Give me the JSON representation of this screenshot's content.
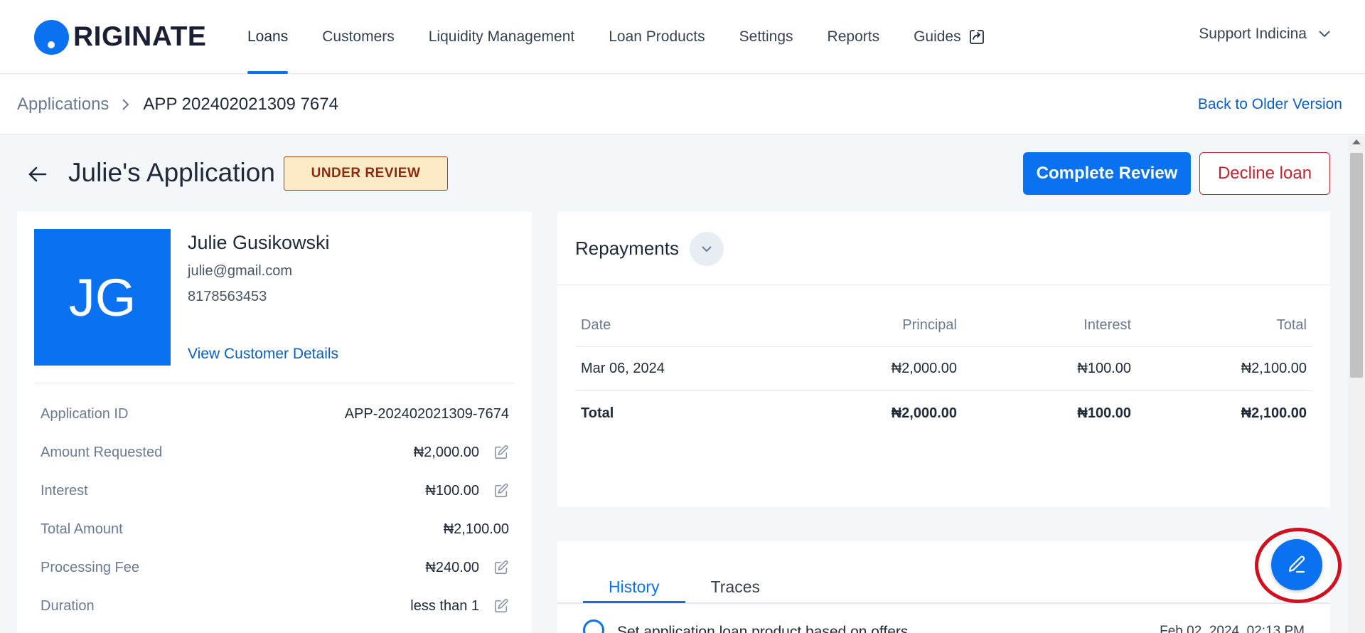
{
  "brand": {
    "logo_text": "RIGINATE",
    "accent": "#0a72f0"
  },
  "nav": {
    "items": [
      {
        "label": "Loans",
        "active": true
      },
      {
        "label": "Customers"
      },
      {
        "label": "Liquidity Management"
      },
      {
        "label": "Loan Products"
      },
      {
        "label": "Settings"
      },
      {
        "label": "Reports"
      },
      {
        "label": "Guides",
        "icon": "external-link-icon"
      }
    ],
    "user": "Support Indicina"
  },
  "breadcrumb": {
    "parent": "Applications",
    "current": "APP 202402021309 7674",
    "back_link": "Back to Older Version"
  },
  "header": {
    "title": "Julie's Application",
    "status": "UNDER REVIEW",
    "complete_button": "Complete Review",
    "decline_button": "Decline loan"
  },
  "customer": {
    "initials": "JG",
    "name": "Julie Gusikowski",
    "email": "julie@gmail.com",
    "phone": "8178563453",
    "details_link": "View Customer Details"
  },
  "details": [
    {
      "label": "Application ID",
      "value": "APP-202402021309-7674",
      "editable": false
    },
    {
      "label": "Amount Requested",
      "value": "₦2,000.00",
      "editable": true
    },
    {
      "label": "Interest",
      "value": "₦100.00",
      "editable": true
    },
    {
      "label": "Total Amount",
      "value": "₦2,100.00",
      "editable": false
    },
    {
      "label": "Processing Fee",
      "value": "₦240.00",
      "editable": true
    },
    {
      "label": "Duration",
      "value": "less than 1",
      "editable": true
    }
  ],
  "repayments": {
    "title": "Repayments",
    "columns": [
      "Date",
      "Principal",
      "Interest",
      "Total"
    ],
    "rows": [
      {
        "date": "Mar 06, 2024",
        "principal": "₦2,000.00",
        "interest": "₦100.00",
        "total": "₦2,100.00"
      }
    ],
    "totals": {
      "label": "Total",
      "principal": "₦2,000.00",
      "interest": "₦100.00",
      "total": "₦2,100.00"
    }
  },
  "history": {
    "tabs": [
      "History",
      "Traces"
    ],
    "active_tab": "History",
    "entry_text": "Set application loan product based on offers",
    "entry_date": "Feb 02, 2024, 02:13 PM"
  }
}
